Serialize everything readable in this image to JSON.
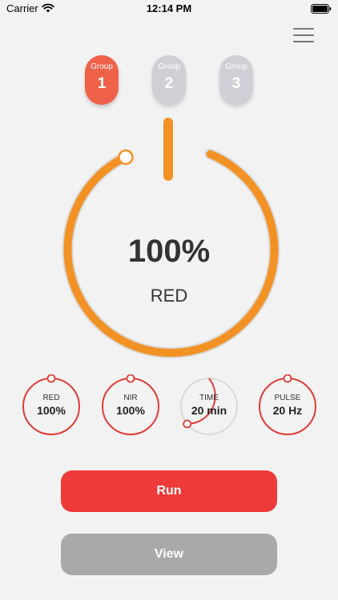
{
  "status_bar": {
    "carrier": "Carrier",
    "time": "12:14 PM"
  },
  "groups": [
    {
      "label": "Group",
      "number": "1",
      "active": true
    },
    {
      "label": "Group",
      "number": "2",
      "active": false
    },
    {
      "label": "Group",
      "number": "3",
      "active": false
    }
  ],
  "main_dial": {
    "value": "100%",
    "label": "RED",
    "level_percent": 100,
    "color": "#f39224"
  },
  "mini_dials": [
    {
      "label": "RED",
      "value": "100%",
      "level_percent": 100
    },
    {
      "label": "NIR",
      "value": "100%",
      "level_percent": 100
    },
    {
      "label": "TIME",
      "value": "20 min",
      "level_percent": 38
    },
    {
      "label": "PULSE",
      "value": "20 Hz",
      "level_percent": 100
    }
  ],
  "buttons": {
    "run": "Run",
    "view": "View"
  },
  "colors": {
    "accent": "#f0614a",
    "dial_orange": "#f39224",
    "mini_ring": "#e03c36",
    "run": "#ee3a3a",
    "view": "#a9a9a9"
  }
}
